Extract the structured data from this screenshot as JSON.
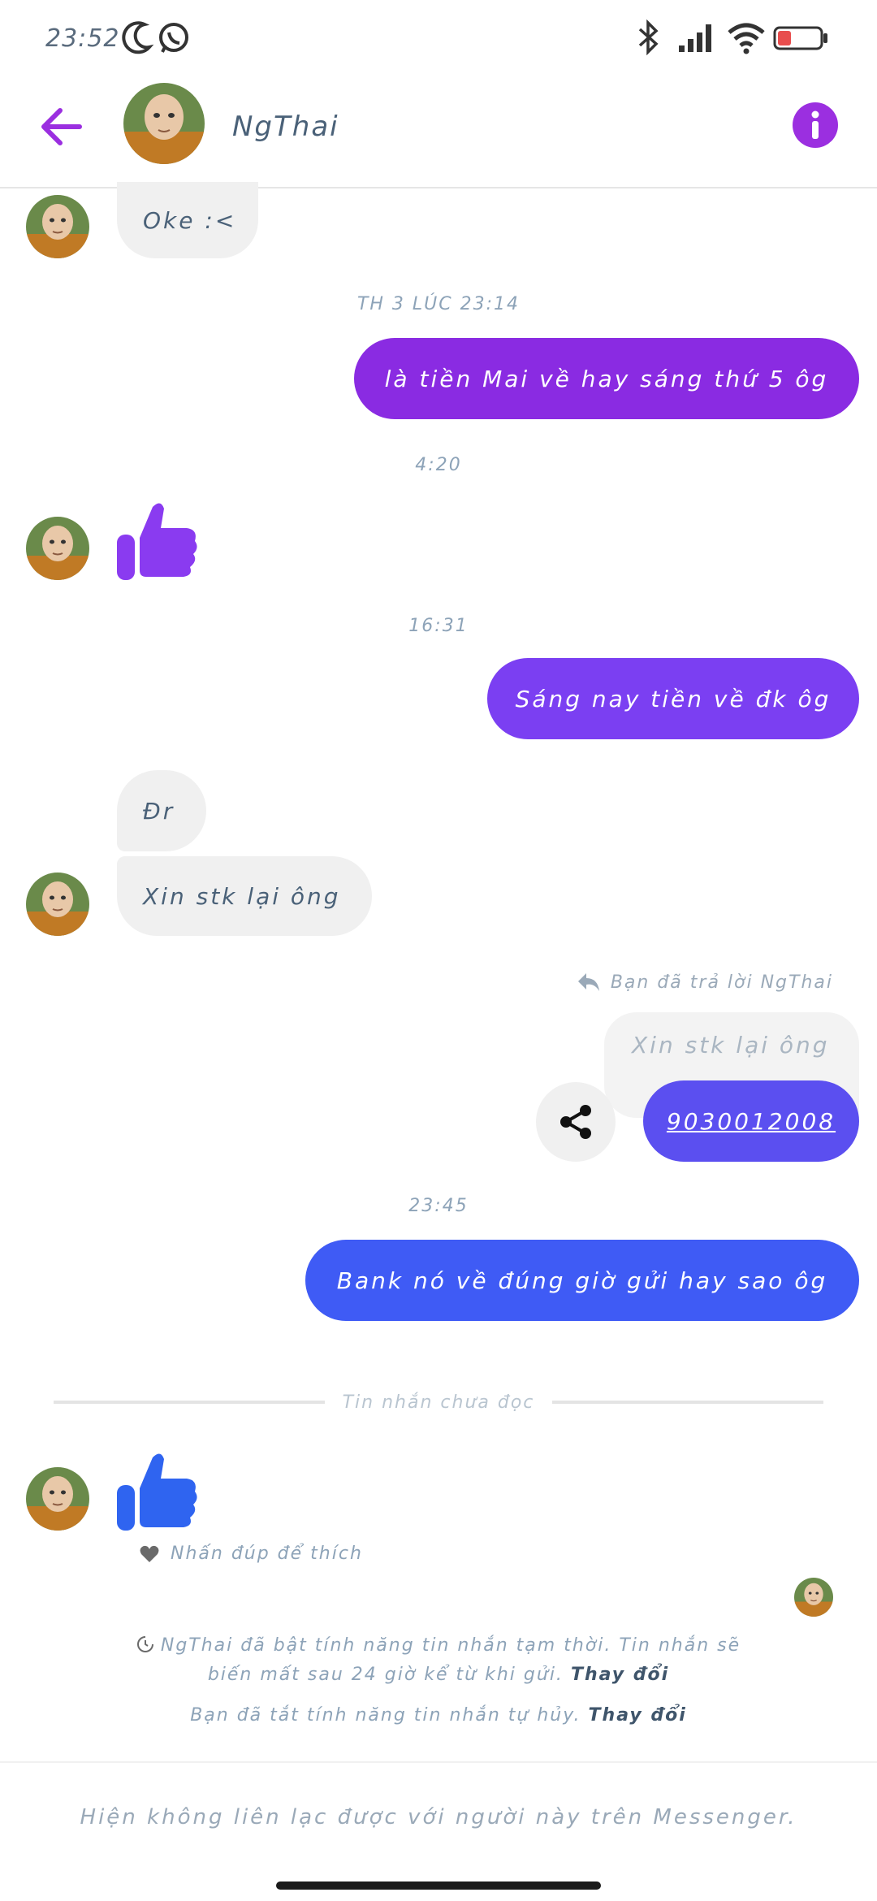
{
  "status_bar": {
    "time": "23:52",
    "battery": "33"
  },
  "header": {
    "contact_name": "NgThai"
  },
  "messages": {
    "m1": "Oke :<",
    "ts1": "TH 3 LÚC 23:14",
    "m2": "là tiền Mai về hay sáng thứ 5 ôg",
    "ts2": "4:20",
    "ts3": "16:31",
    "m3": "Sáng nay tiền về đk ôg",
    "m4": "Đr",
    "m5": "Xin stk lại ông",
    "reply_note": "Bạn đã trả lời NgThai",
    "reply_quote": "Xin stk lại ông",
    "m6": "9030012008",
    "ts4": "23:45",
    "m7": "Bank nó về đúng giờ gửi hay sao ôg"
  },
  "unread_divider": "Tin nhắn chưa đọc",
  "double_tap_hint": "Nhấn đúp để thích",
  "notices": {
    "temp_messages": "NgThai đã bật tính năng tin nhắn tạm thời. Tin nhắn sẽ biến mất sau 24 giờ kể từ khi gửi.",
    "temp_change": "Thay đổi",
    "self_destruct": "Bạn đã tắt tính năng tin nhắn tự hủy.",
    "self_destruct_change": "Thay đổi"
  },
  "footer": {
    "text": "Hiện không liên lạc được với người này trên Messenger."
  },
  "colors": {
    "accent": "#9b2fe0",
    "bubble_purple": "#8a2be2",
    "bubble_violet": "#7b3ff2",
    "bubble_indigo": "#5b4ff0",
    "bubble_blue": "#3f5bf5",
    "thumb_purple": "#8a3bf0",
    "thumb_blue": "#2f64f0"
  }
}
